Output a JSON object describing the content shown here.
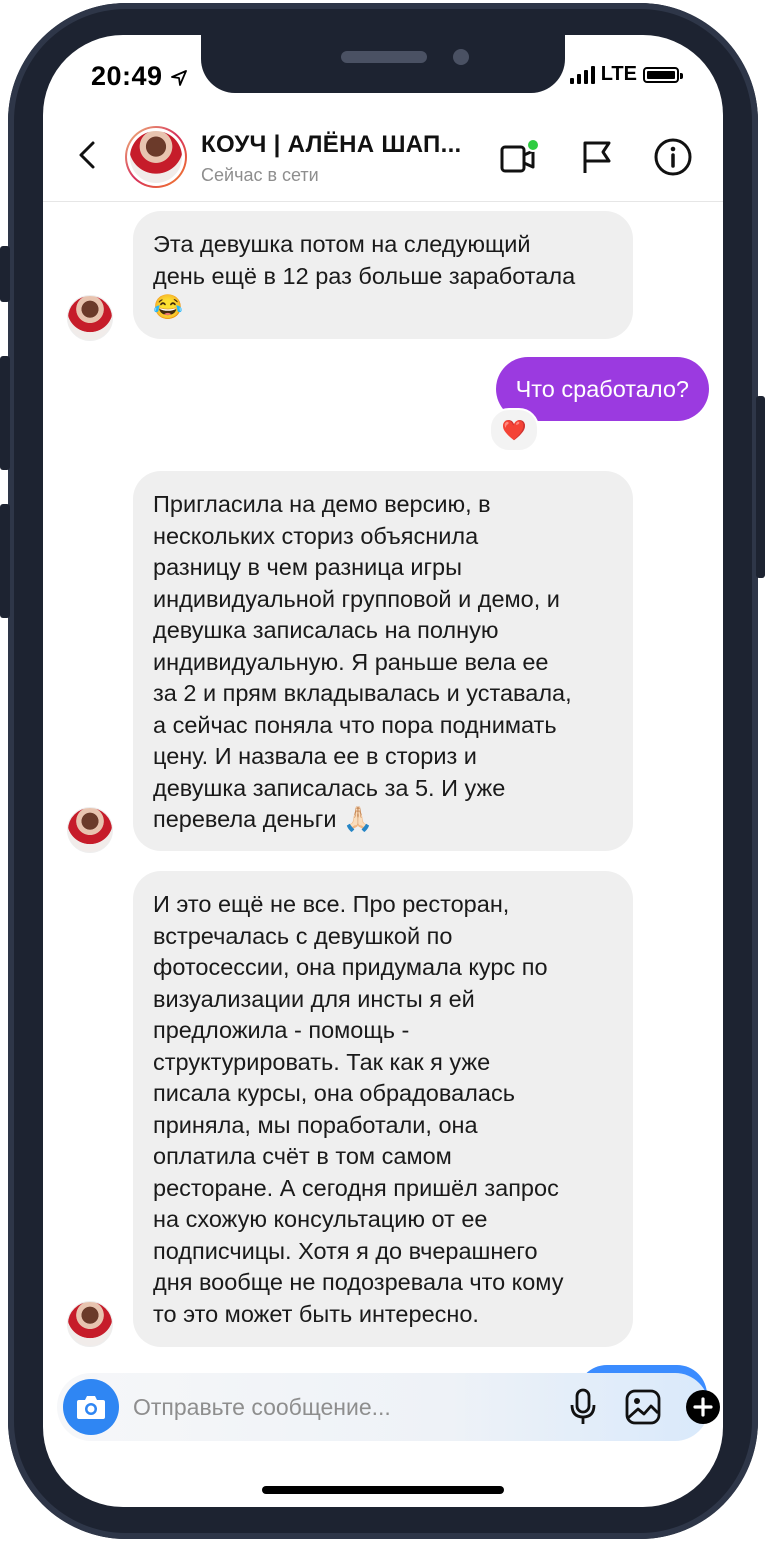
{
  "status_bar": {
    "time": "20:49",
    "network": "LTE"
  },
  "header": {
    "contact_name": "КОУЧ | АЛЁНА ШАП...",
    "contact_status": "Сейчас в сети",
    "icons": [
      "back-icon",
      "video-call-icon",
      "flag-icon",
      "info-icon"
    ],
    "video_online_dot_color": "#2ecc40"
  },
  "messages": [
    {
      "id": "m1",
      "direction": "in",
      "lines": [
        "Эта девушка потом на следующий",
        "день ещё в 12 раз больше заработала"
      ],
      "emoji": "😂"
    },
    {
      "id": "m2",
      "direction": "out",
      "text": "Что сработало?",
      "reaction": "❤️"
    },
    {
      "id": "m3",
      "direction": "in",
      "lines": [
        "Пригласила на демо версию, в",
        "нескольких сториз объяснила",
        "разницу в чем разница игры",
        "индивидуальной групповой и демо, и",
        "девушка записалась на полную",
        "индивидуальную. Я раньше вела ее",
        "за 2 и прям вкладывалась и уставала,",
        "а сейчас поняла что пора поднимать",
        "цену. И назвала ее в сториз и",
        "девушка записалась за 5. И уже",
        "перевела деньги"
      ],
      "emoji": "🙏🏻"
    },
    {
      "id": "m4",
      "direction": "in",
      "lines": [
        "И это ещё не все. Про ресторан,",
        "встречалась с девушкой по",
        "фотосессии, она придумала курс по",
        "визуализации для инсты я ей",
        "предложила - помощь -",
        "структурировать. Так как я уже",
        "писала курсы, она обрадовалась",
        "приняла, мы поработали, она",
        "оплатила счёт в том самом",
        "ресторане. А сегодня пришёл запрос",
        "на схожую консультацию от ее",
        "подписчицы. Хотя я до вчерашнего",
        "дня вообще не подозревала что кому",
        "то это может быть интересно."
      ]
    }
  ],
  "composer": {
    "placeholder": "Отправьте сообщение...",
    "icons": [
      "camera-icon",
      "microphone-icon",
      "gallery-icon",
      "plus-icon"
    ],
    "accent_color": "#2f86f3"
  },
  "colors": {
    "outgoing_bubble": "#9b3ae0",
    "incoming_bubble": "#efefef",
    "frame": "#1d2331"
  }
}
